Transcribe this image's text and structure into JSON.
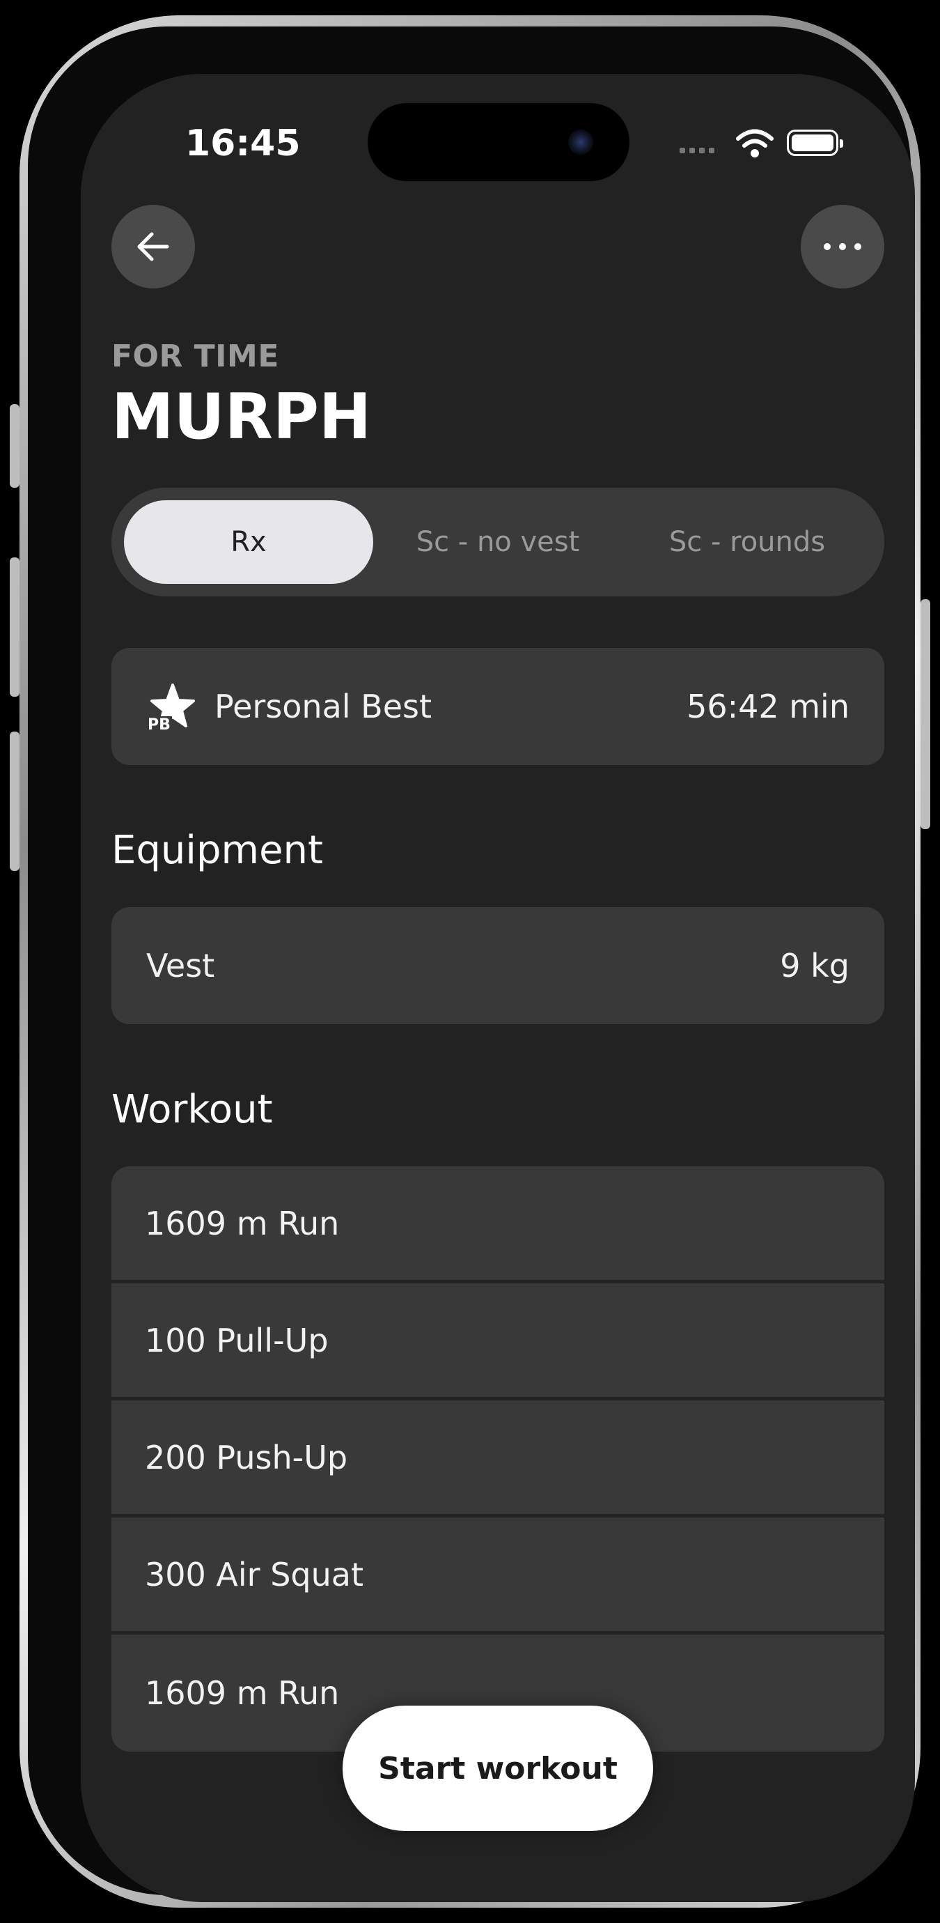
{
  "status_bar": {
    "time": "16:45"
  },
  "header": {
    "back_icon": "arrow-left-icon",
    "more_icon": "more-horizontal-icon",
    "subtitle": "FOR TIME",
    "title": "MURPH"
  },
  "segmented": {
    "options": [
      "Rx",
      "Sc - no vest",
      "Sc - rounds"
    ],
    "selected": "Rx"
  },
  "personal_best": {
    "icon": "star-pb-icon",
    "tag": "PB",
    "label": "Personal Best",
    "value": "56:42 min"
  },
  "equipment": {
    "title": "Equipment",
    "items": [
      {
        "label": "Vest",
        "value": "9 kg"
      }
    ]
  },
  "workout": {
    "title": "Workout",
    "items": [
      "1609 m Run",
      "100 Pull-Up",
      "200 Push-Up",
      "300 Air Squat",
      "1609 m Run"
    ]
  },
  "actions": {
    "start_label": "Start workout"
  },
  "colors": {
    "background": "#222222",
    "card": "#393939",
    "segment_active": "#e6e6eb",
    "muted_text": "#9a9a9a",
    "primary_button": "#ffffff"
  }
}
